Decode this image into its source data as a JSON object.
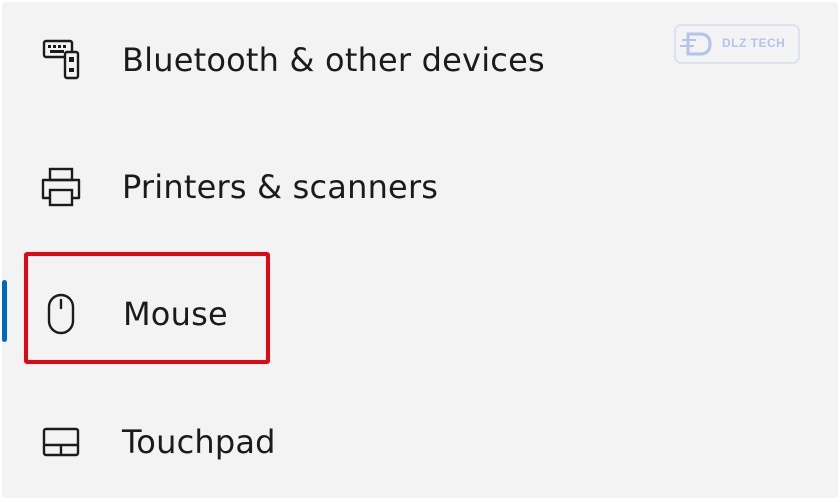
{
  "settings_nav": {
    "items": [
      {
        "label": "Bluetooth & other devices",
        "icon": "bluetooth-devices-icon"
      },
      {
        "label": "Printers & scanners",
        "icon": "printer-icon"
      },
      {
        "label": "Mouse",
        "icon": "mouse-icon",
        "selected": true
      },
      {
        "label": "Touchpad",
        "icon": "touchpad-icon"
      }
    ]
  },
  "watermark": {
    "text": "DLZ TECH"
  },
  "colors": {
    "accent": "#0067c0",
    "highlight": "#e30613",
    "background": "#f3f3f3",
    "text": "#1b1b1b"
  }
}
